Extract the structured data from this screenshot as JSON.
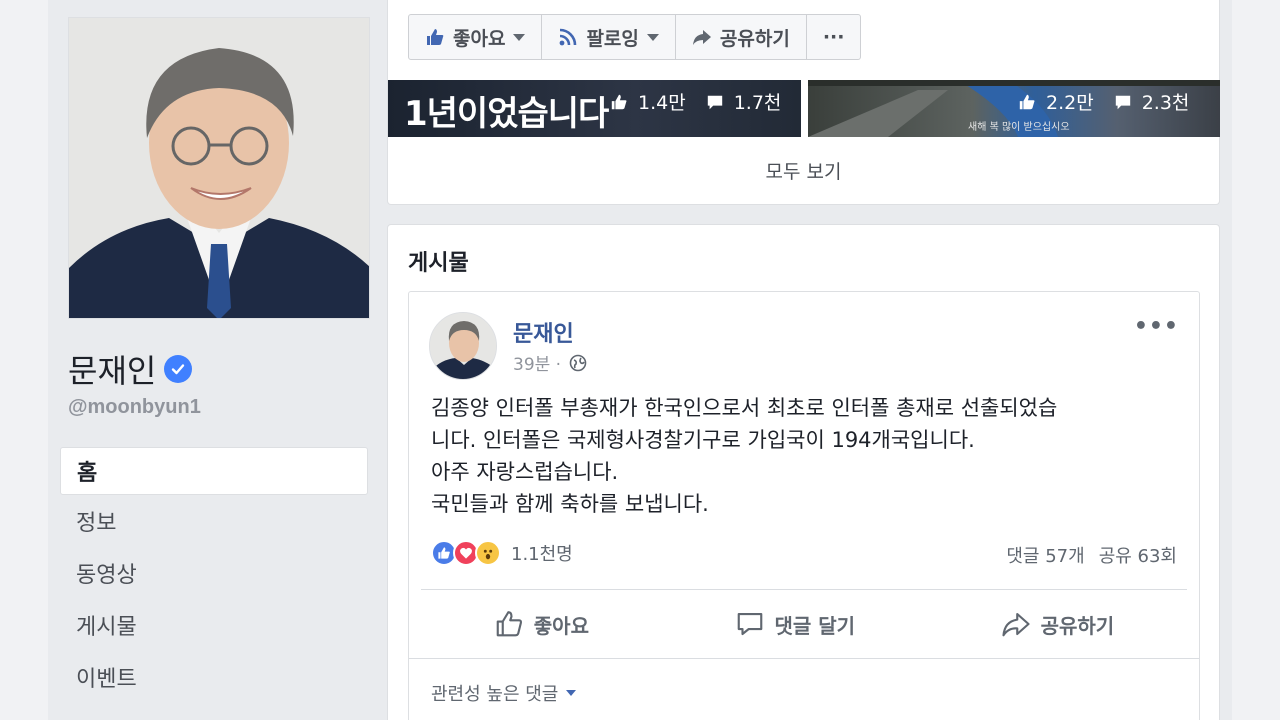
{
  "profile": {
    "name": "문재인",
    "handle": "@moonbyun1",
    "nav": [
      {
        "label": "홈",
        "active": true
      },
      {
        "label": "정보",
        "active": false
      },
      {
        "label": "동영상",
        "active": false
      },
      {
        "label": "게시물",
        "active": false
      },
      {
        "label": "이벤트",
        "active": false
      }
    ]
  },
  "action_bar": {
    "like_label": "좋아요",
    "follow_label": "팔로잉",
    "share_label": "공유하기",
    "more_label": "···"
  },
  "videos": [
    {
      "headline": "1년이었습니다",
      "likes": "1.4만",
      "comments": "1.7천"
    },
    {
      "caption": "새해 복 많이 받으십시오",
      "likes": "2.2만",
      "comments": "2.3천"
    }
  ],
  "see_all": "모두 보기",
  "posts_section": {
    "heading": "게시물",
    "post": {
      "author": "문재인",
      "time": "39분 ·",
      "more": "•••",
      "lines": [
        "김종양 인터폴 부총재가 한국인으로서 최초로 인터폴 총재로 선출되었습",
        "니다. 인터폴은 국제형사경찰기구로 가입국이 194개국입니다.",
        "아주 자랑스럽습니다.",
        "국민들과 함께 축하를 보냅니다."
      ],
      "reaction_count": "1.1천명",
      "comments": "댓글 57개",
      "shares": "공유 63회",
      "actions": {
        "like": "좋아요",
        "comment": "댓글 달기",
        "share": "공유하기"
      },
      "comment_filter": "관련성 높은 댓글"
    }
  },
  "colors": {
    "link": "#385898",
    "accent": "#4267b2",
    "background": "#e9ebee"
  }
}
